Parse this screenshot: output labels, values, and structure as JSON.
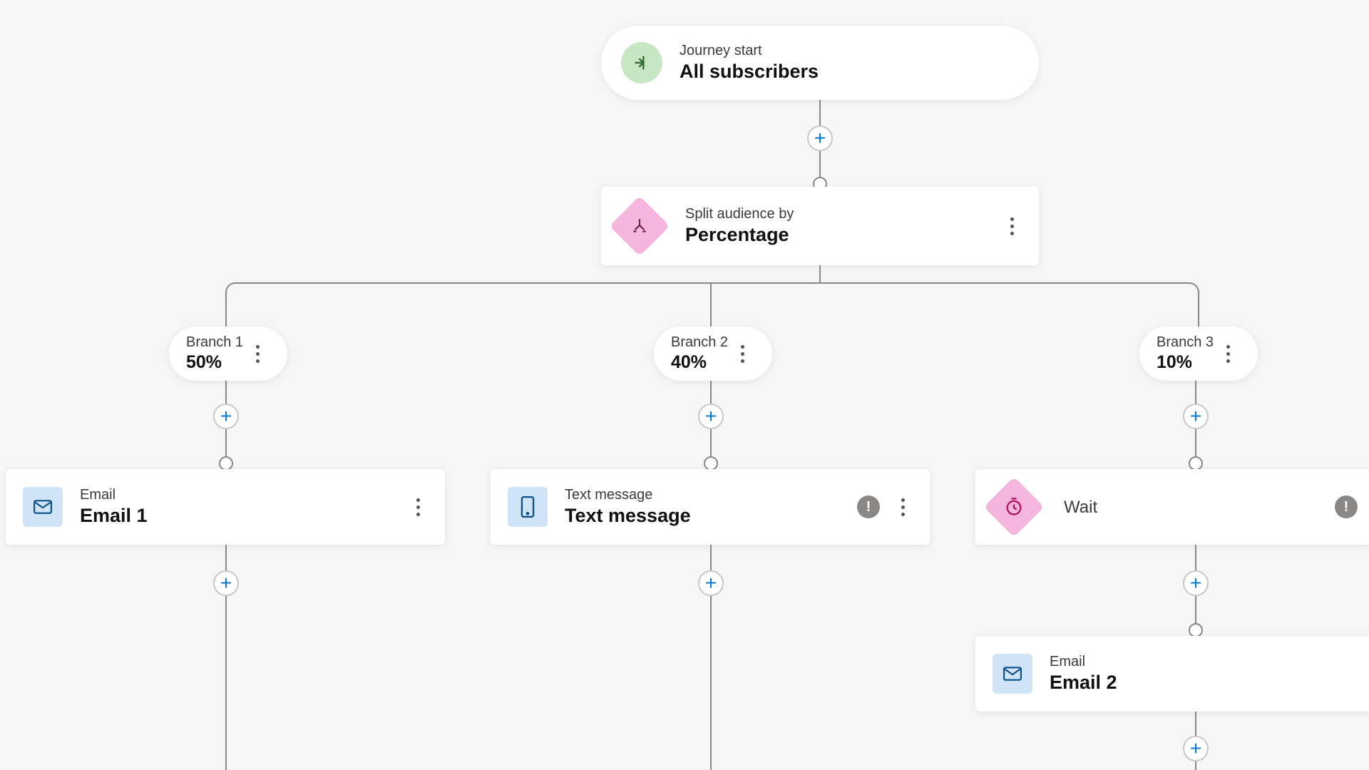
{
  "start": {
    "sub": "Journey start",
    "title": "All subscribers"
  },
  "split": {
    "sub": "Split audience by",
    "title": "Percentage"
  },
  "branches": [
    {
      "label": "Branch 1",
      "pct": "50%"
    },
    {
      "label": "Branch 2",
      "pct": "40%"
    },
    {
      "label": "Branch 3",
      "pct": "10%"
    }
  ],
  "email1": {
    "sub": "Email",
    "title": "Email 1"
  },
  "sms": {
    "sub": "Text message",
    "title": "Text message"
  },
  "wait": {
    "title": "Wait"
  },
  "email2": {
    "sub": "Email",
    "title": "Email 2"
  }
}
